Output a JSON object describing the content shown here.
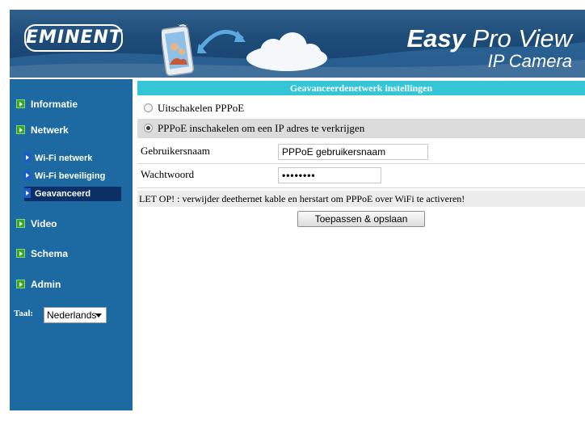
{
  "header": {
    "logo_text": "EMINENT",
    "brand_bold": "Easy",
    "brand_rest": " Pro View",
    "brand_sub": "IP Camera"
  },
  "sidebar": {
    "items": [
      {
        "label": "Informatie"
      },
      {
        "label": "Netwerk"
      },
      {
        "label": "Video"
      },
      {
        "label": "Schema"
      },
      {
        "label": "Admin"
      }
    ],
    "sub_items": [
      {
        "label": "Wi-Fi netwerk"
      },
      {
        "label": "Wi-Fi beveiliging"
      },
      {
        "label": "Geavanceerd",
        "active": true
      }
    ],
    "language_label": "Taal:",
    "language_value": "Nederlands"
  },
  "main": {
    "section_title": "Geavanceerdenetwerk instellingen",
    "option_disable": "Uitschakelen PPPoE",
    "option_enable": "PPPoE inschakelen om een IP adres te verkrijgen",
    "username_label": "Gebruikersnaam",
    "username_value": "PPPoE gebruikersnaam",
    "password_label": "Wachtwoord",
    "password_value": "••••••••",
    "warning": "LET OP! : verwijder deethernet kable en herstart om PPPoE over WiFi te activeren!",
    "apply_button": "Toepassen & opslaan"
  },
  "colors": {
    "sidebar_bg": "#1c6aa1",
    "title_bar": "#34c6d6",
    "active_sub": "#0b2f66"
  }
}
